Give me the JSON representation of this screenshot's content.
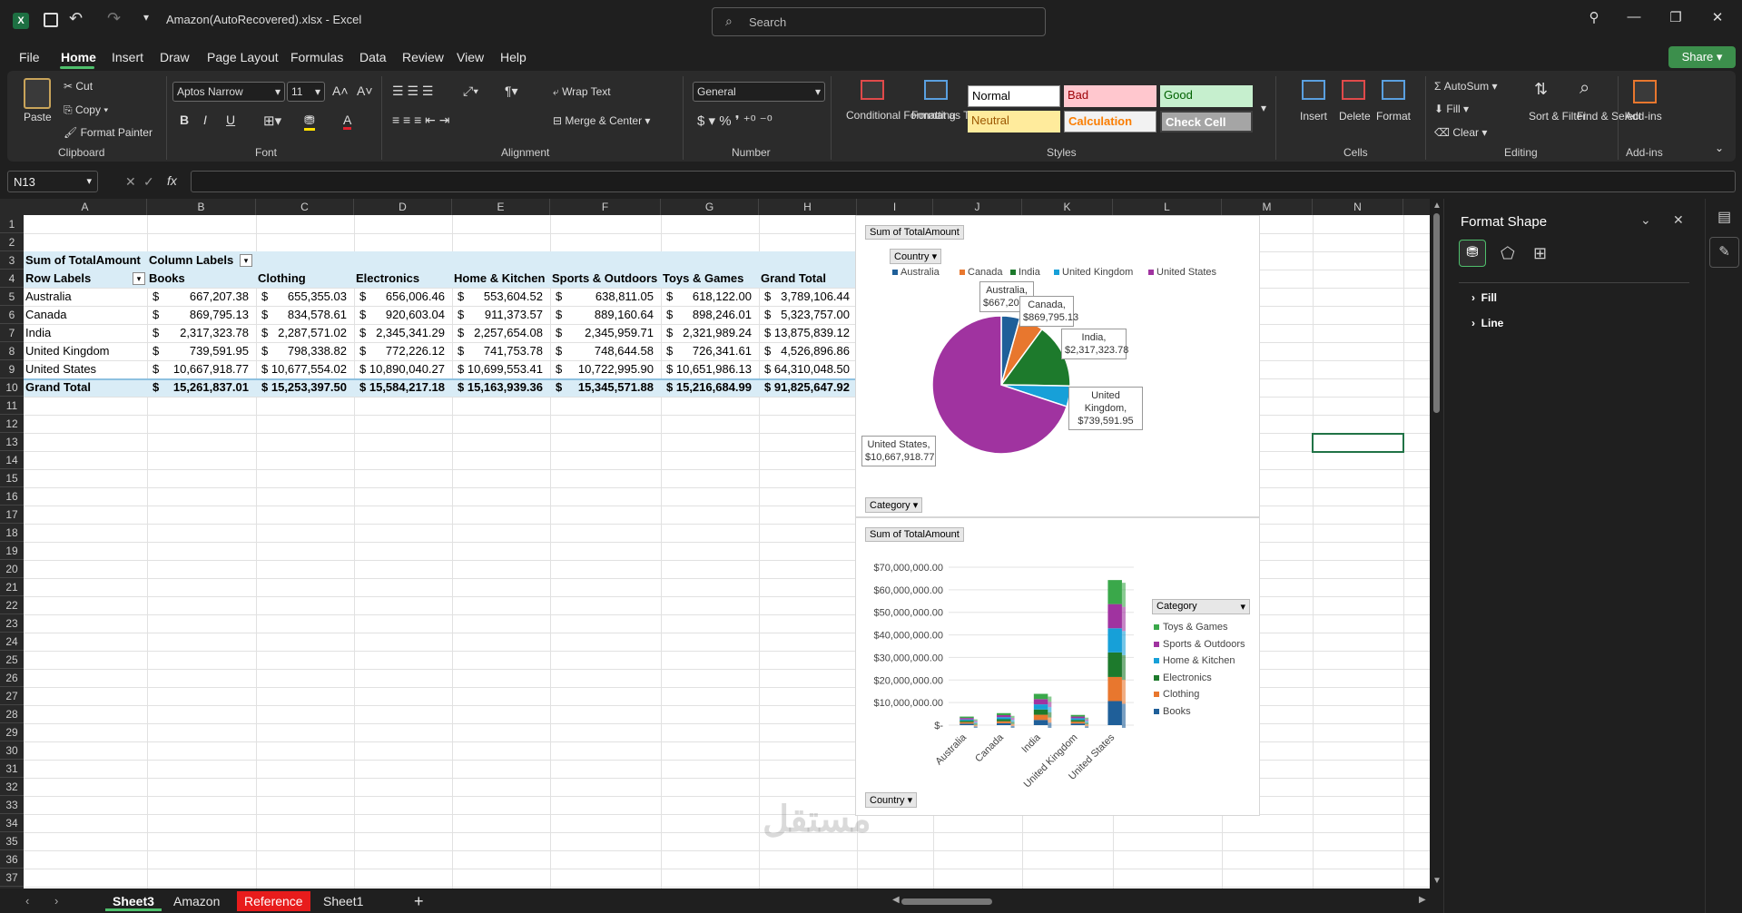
{
  "window": {
    "title": "Amazon(AutoRecovered).xlsx  -  Excel",
    "search_placeholder": "Search"
  },
  "menu": [
    "File",
    "Home",
    "Insert",
    "Draw",
    "Page Layout",
    "Formulas",
    "Data",
    "Review",
    "View",
    "Help"
  ],
  "share_label": "Share",
  "ribbon": {
    "clipboard": {
      "group": "Clipboard",
      "paste": "Paste",
      "cut": "Cut",
      "copy": "Copy",
      "format_painter": "Format Painter"
    },
    "font": {
      "group": "Font",
      "name": "Aptos Narrow",
      "size": "11",
      "bold": "B",
      "italic": "I",
      "underline": "U"
    },
    "alignment": {
      "group": "Alignment",
      "wrap": "Wrap Text",
      "merge": "Merge & Center"
    },
    "number": {
      "group": "Number",
      "format": "General"
    },
    "styles": {
      "group": "Styles",
      "conditional": "Conditional Formatting",
      "format_table": "Format as Table",
      "normal": "Normal",
      "bad": "Bad",
      "good": "Good",
      "neutral": "Neutral",
      "calculation": "Calculation",
      "check": "Check Cell"
    },
    "cells": {
      "group": "Cells",
      "insert": "Insert",
      "delete": "Delete",
      "format": "Format"
    },
    "editing": {
      "group": "Editing",
      "autosum": "AutoSum",
      "fill": "Fill",
      "clear": "Clear",
      "sort": "Sort & Filter",
      "find": "Find & Select"
    },
    "addins": {
      "group": "Add-ins",
      "label": "Add-ins"
    }
  },
  "namebox": "N13",
  "columns": [
    "A",
    "B",
    "C",
    "D",
    "E",
    "F",
    "G",
    "H",
    "I",
    "J",
    "K",
    "L",
    "M",
    "N"
  ],
  "rows": [
    "1",
    "2",
    "3",
    "4",
    "5",
    "6",
    "7",
    "8",
    "9",
    "10",
    "11",
    "12",
    "13",
    "14",
    "15",
    "16",
    "17",
    "18",
    "19",
    "20",
    "21",
    "22",
    "23",
    "24",
    "25",
    "26",
    "27",
    "28",
    "29",
    "30",
    "31",
    "32",
    "33",
    "34",
    "35",
    "36",
    "37"
  ],
  "pivot": {
    "title": "Sum of TotalAmount",
    "column_labels": "Column Labels",
    "row_labels": "Row Labels",
    "headers": [
      "Books",
      "Clothing",
      "Electronics",
      "Home & Kitchen",
      "Sports & Outdoors",
      "Toys & Games",
      "Grand Total"
    ],
    "rows": [
      {
        "label": "Australia",
        "values": [
          "667,207.38",
          "655,355.03",
          "656,006.46",
          "553,604.52",
          "638,811.05",
          "618,122.00",
          "3,789,106.44"
        ]
      },
      {
        "label": "Canada",
        "values": [
          "869,795.13",
          "834,578.61",
          "920,603.04",
          "911,373.57",
          "889,160.64",
          "898,246.01",
          "5,323,757.00"
        ]
      },
      {
        "label": "India",
        "values": [
          "2,317,323.78",
          "2,287,571.02",
          "2,345,341.29",
          "2,257,654.08",
          "2,345,959.71",
          "2,321,989.24",
          "13,875,839.12"
        ]
      },
      {
        "label": "United Kingdom",
        "values": [
          "739,591.95",
          "798,338.82",
          "772,226.12",
          "741,753.78",
          "748,644.58",
          "726,341.61",
          "4,526,896.86"
        ]
      },
      {
        "label": "United States",
        "values": [
          "10,667,918.77",
          "10,677,554.02",
          "10,890,040.27",
          "10,699,553.41",
          "10,722,995.90",
          "10,651,986.13",
          "64,310,048.50"
        ]
      }
    ],
    "grand_total": {
      "label": "Grand Total",
      "values": [
        "15,261,837.01",
        "15,253,397.50",
        "15,584,217.18",
        "15,163,939.36",
        "15,345,571.88",
        "15,216,684.99",
        "91,825,647.92"
      ]
    },
    "currency": "$"
  },
  "chart_data": [
    {
      "type": "pie",
      "title": "Sum of TotalAmount",
      "filter_button": "Country",
      "bottom_button": "Category",
      "categories": [
        "Australia",
        "Canada",
        "India",
        "United Kingdom",
        "United States"
      ],
      "values": [
        667207.38,
        869795.13,
        2317323.78,
        739591.95,
        10667918.77
      ],
      "data_labels": [
        "Australia, $667,207.38",
        "Canada, $869,795.13",
        "India, $2,317,323.78",
        "United Kingdom, $739,591.95",
        "United States, $10,667,918.77"
      ],
      "colors": [
        "#1f5f99",
        "#e8772e",
        "#1d7a2c",
        "#17a0d8",
        "#a033a0"
      ],
      "legend": "top"
    },
    {
      "type": "bar",
      "stacked": true,
      "title": "Sum of TotalAmount",
      "bottom_button": "Country",
      "legend_button": "Category",
      "categories": [
        "Australia",
        "Canada",
        "India",
        "United Kingdom",
        "United States"
      ],
      "series": [
        {
          "name": "Books",
          "values": [
            667207.38,
            869795.13,
            2317323.78,
            739591.95,
            10667918.77
          ],
          "color": "#1f5f99"
        },
        {
          "name": "Clothing",
          "values": [
            655355.03,
            834578.61,
            2287571.02,
            798338.82,
            10677554.02
          ],
          "color": "#e8772e"
        },
        {
          "name": "Electronics",
          "values": [
            656006.46,
            920603.04,
            2345341.29,
            772226.12,
            10890040.27
          ],
          "color": "#1d7a2c"
        },
        {
          "name": "Home & Kitchen",
          "values": [
            553604.52,
            911373.57,
            2257654.08,
            741753.78,
            10699553.41
          ],
          "color": "#17a0d8"
        },
        {
          "name": "Sports & Outdoors",
          "values": [
            638811.05,
            889160.64,
            2345959.71,
            748644.58,
            10722995.9
          ],
          "color": "#a033a0"
        },
        {
          "name": "Toys & Games",
          "values": [
            618122.0,
            898246.01,
            2321989.24,
            726341.61,
            10651986.13
          ],
          "color": "#3aa84a"
        }
      ],
      "yticks": [
        "$-",
        "$10,000,000.00",
        "$20,000,000.00",
        "$30,000,000.00",
        "$40,000,000.00",
        "$50,000,000.00",
        "$60,000,000.00",
        "$70,000,000.00"
      ],
      "ylim": [
        0,
        70000000
      ],
      "legend": "right"
    }
  ],
  "sheets": [
    {
      "name": "Sheet3",
      "active": true
    },
    {
      "name": "Amazon"
    },
    {
      "name": "Reference",
      "red": true
    },
    {
      "name": "Sheet1"
    }
  ],
  "panel": {
    "title": "Format Shape",
    "fill": "Fill",
    "line": "Line"
  }
}
